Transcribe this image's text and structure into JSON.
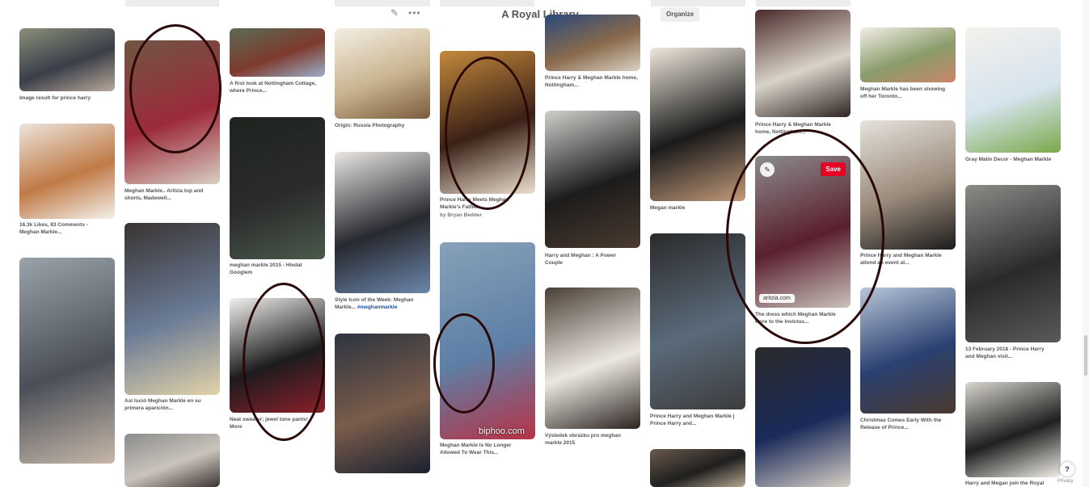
{
  "board": {
    "title": "A Royal Library",
    "edit_icon": "pencil-icon",
    "more_icon": "ellipsis-icon",
    "organize_label": "Organize"
  },
  "pins": [
    {
      "caption": "Image result for prince harry",
      "colors": [
        "#8a8f7a",
        "#3a3e49",
        "#b9a899"
      ]
    },
    {
      "caption": "16.3k Likes, 83 Comments - Meghan Markle...",
      "colors": [
        "#ece5dc",
        "#c07a46",
        "#f4f1ec"
      ]
    },
    {
      "caption": "",
      "colors": [
        "#9aa3a9",
        "#4a4f58",
        "#c6b7a8"
      ]
    },
    {
      "caption": "Meghan Markle.. Aritzia top and shorts, Madewell...",
      "colors": [
        "#6f5643",
        "#9c2a3a",
        "#d8cfc2"
      ]
    },
    {
      "caption": "Así lució Meghan Markle en su primera aparición...",
      "colors": [
        "#3a3433",
        "#6a7b96",
        "#e2d2a8"
      ]
    },
    {
      "caption": "",
      "colors": [
        "#8c8c8c",
        "#c9c4bb",
        "#3c3431"
      ]
    },
    {
      "caption": "A first look at Nottingham Cottage, where Prince...",
      "colors": [
        "#5a6b55",
        "#7e3a2e",
        "#9ab0c9"
      ]
    },
    {
      "caption": "meghan markle 2015 - Hledat Googlem",
      "colors": [
        "#1e241f",
        "#2b2b2b",
        "#4a5a4c"
      ]
    },
    {
      "caption": "Neat sweater; jewel tone pants! More",
      "colors": [
        "#f2f0ee",
        "#1c1c1e",
        "#8b1f2a"
      ]
    },
    {
      "caption": "Origin: Russia Photography",
      "colors": [
        "#f3efe5",
        "#c9b38e",
        "#7a5c3c"
      ]
    },
    {
      "caption": "Style Icon of the Week: Meghan Markle...",
      "hashtag": "#meghanmarkle",
      "colors": [
        "#e9e7e4",
        "#27292f",
        "#6b86ab"
      ]
    },
    {
      "caption": "",
      "colors": [
        "#2d3440",
        "#7a5c4a",
        "#1a2130"
      ]
    },
    {
      "caption": "Prince Harry Meets Meghan Markle's Father...",
      "source": "by Bryan Bedder",
      "colors": [
        "#c4893c",
        "#3a2016",
        "#ede3cf"
      ]
    },
    {
      "caption": "Meghan Markle Is No Longer Allowed To Wear This...",
      "overlay": "biphoo.com",
      "colors": [
        "#87a1b8",
        "#5d7fa6",
        "#b83246"
      ]
    },
    {
      "caption": "Prince Harry & Meghan Markle home, Nottingham...",
      "colors": [
        "#2a4a7a",
        "#8a6a4c",
        "#d9d3c6"
      ]
    },
    {
      "caption": "Harry and Meghan : A Power Couple",
      "colors": [
        "#cfcfcc",
        "#1c1c1c",
        "#4a3a2e"
      ]
    },
    {
      "caption": "Výsledek obrázku pro meghan markle 2015",
      "colors": [
        "#4a3f36",
        "#ece8e0",
        "#2a2320"
      ]
    },
    {
      "caption": "Megan markle",
      "colors": [
        "#efe8dc",
        "#1a1a1a",
        "#c29a7a"
      ]
    },
    {
      "caption": "Prince Harry and Meghan Markle | Prince Harry and...",
      "colors": [
        "#2b2b2b",
        "#5a6a7a",
        "#3c3c3c"
      ]
    },
    {
      "caption": "",
      "colors": [
        "#6b5a4c",
        "#1f1f1f",
        "#b8a892"
      ]
    },
    {
      "caption": "Prince Harry & Meghan Markle home, Nottingham...",
      "colors": [
        "#4a2a2a",
        "#d9d3c9",
        "#2f2421"
      ]
    },
    {
      "caption": "The dress which Meghan Markle wore to the Invictus...",
      "badge": "aritzia.com",
      "save_label": "Save",
      "save_icon": "pin-icon",
      "edit_icon": "pencil-icon",
      "colors": [
        "#8b8b8b",
        "#5a1f2e",
        "#c9c2bb"
      ]
    },
    {
      "caption": "",
      "colors": [
        "#2a2a2a",
        "#1a2a5a",
        "#d8d0c6"
      ]
    },
    {
      "caption": "Meghan Markle has been showing off her Toronto...",
      "colors": [
        "#f2eee8",
        "#8a9c6a",
        "#c8866a"
      ]
    },
    {
      "caption": "Prince Harry and Meghan Markle attend an event at...",
      "colors": [
        "#e6e2dc",
        "#9a8a7a",
        "#1c1c1c"
      ]
    },
    {
      "caption": "Christmas Comes Early With the Release of Prince...",
      "colors": [
        "#b8c6d9",
        "#2a4070",
        "#4a3a2e"
      ]
    },
    {
      "caption": "Gray Malin Decor - Meghan Markle",
      "colors": [
        "#f4f1ec",
        "#d6e4ee",
        "#7aa84a"
      ]
    },
    {
      "caption": "13 February 2018 - Prince Harry and Meghan visit...",
      "colors": [
        "#8c8b88",
        "#2a2a2a",
        "#5a5a5a"
      ]
    },
    {
      "caption": "Harry and Megan join the Royal",
      "colors": [
        "#d9d6d0",
        "#1f1f1f",
        "#f2efe9"
      ]
    }
  ],
  "help": {
    "label": "?",
    "privacy": "Privacy"
  }
}
